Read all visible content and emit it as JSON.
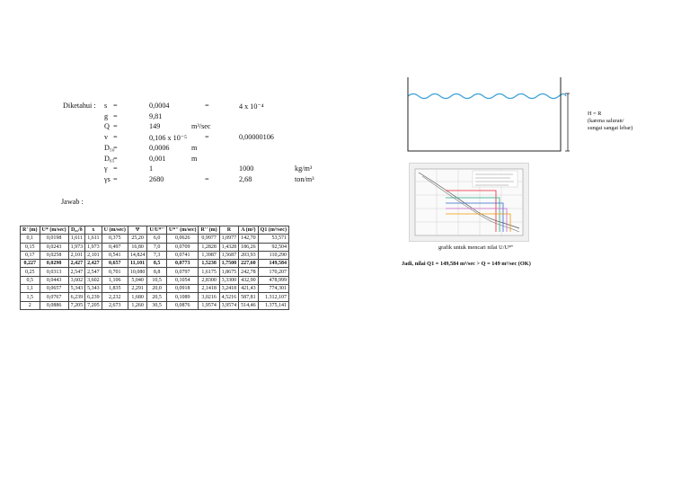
{
  "given": {
    "title": "Diketahui :",
    "rows": [
      {
        "sym": "s",
        "eq": "=",
        "val": "0,0004",
        "unit": "",
        "eq2": "=",
        "val2": "4 x 10⁻⁴",
        "unit2": ""
      },
      {
        "sym": "g",
        "eq": "=",
        "val": "9,81",
        "unit": "",
        "eq2": "",
        "val2": "",
        "unit2": ""
      },
      {
        "sym": "Q",
        "eq": "=",
        "val": "149",
        "unit": "m³/sec",
        "eq2": "",
        "val2": "",
        "unit2": ""
      },
      {
        "sym": "v",
        "eq": "=",
        "val": "0,106 x 10⁻⁵",
        "unit": "",
        "eq2": "=",
        "val2": "0,00000106",
        "unit2": ""
      },
      {
        "sym": "D₅₀",
        "eq": "=",
        "val": "0,0006",
        "unit": "m",
        "eq2": "",
        "val2": "",
        "unit2": ""
      },
      {
        "sym": "D₆₅",
        "eq": "=",
        "val": "0,001",
        "unit": "m",
        "eq2": "",
        "val2": "",
        "unit2": ""
      },
      {
        "sym": "γ",
        "eq": "=",
        "val": "1",
        "unit": "",
        "eq2": "",
        "val2": "1000",
        "unit2": "kg/m³"
      },
      {
        "sym": "γs",
        "eq": "=",
        "val": "2680",
        "unit": "",
        "eq2": "=",
        "val2": "2,68",
        "unit2": "ton/m³"
      }
    ]
  },
  "jawab": "Jawab :",
  "table": {
    "headers": [
      "R' (m)",
      "U* (m/sec)",
      "D₆₅/δ",
      "x",
      "U (m/sec)",
      "Ψ",
      "U/U*''",
      "U*'' (m/sec)",
      "R'' (m)",
      "R",
      "A (m²)",
      "Q1 (m³/sec)"
    ],
    "rows": [
      [
        "0,1",
        "0,0198",
        "1,611",
        "1,611",
        "0,375",
        "25,20",
        "6,0",
        "0,0626",
        "0,9977",
        "1,0977",
        "142,70",
        "53,571"
      ],
      [
        "0,15",
        "0,0243",
        "1,973",
        "1,973",
        "0,497",
        "16,80",
        "7,0",
        "0,0709",
        "1,2828",
        "1,4328",
        "186,26",
        "92,504"
      ],
      [
        "0,17",
        "0,0258",
        "2,101",
        "2,101",
        "0,541",
        "14,824",
        "7,3",
        "0,0741",
        "1,3987",
        "1,5687",
        "203,93",
        "110,290"
      ],
      [
        "0,227",
        "0,0298",
        "2,427",
        "2,427",
        "0,657",
        "11,101",
        "8,5",
        "0,0773",
        "1,5238",
        "1,7508",
        "227,60",
        "149,584"
      ],
      [
        "0,25",
        "0,0313",
        "2,547",
        "2,547",
        "0,701",
        "10,080",
        "8,8",
        "0,0797",
        "1,6175",
        "1,8675",
        "242,78",
        "170,207"
      ],
      [
        "0,5",
        "0,0443",
        "3,602",
        "3,602",
        "1,106",
        "5,040",
        "10,5",
        "0,1054",
        "2,8300",
        "3,3300",
        "432,90",
        "478,999"
      ],
      [
        "1,1",
        "0,0657",
        "5,343",
        "5,343",
        "1,835",
        "2,291",
        "20,0",
        "0,0918",
        "2,1418",
        "3,2418",
        "421,43",
        "774,301"
      ],
      [
        "1,5",
        "0,0767",
        "6,239",
        "6,239",
        "2,232",
        "1,680",
        "20,5",
        "0,1089",
        "3,0216",
        "4,5216",
        "587,81",
        "1.312,107"
      ],
      [
        "2",
        "0,0886",
        "7,205",
        "7,205",
        "2,673",
        "1,260",
        "30,5",
        "0,0876",
        "1,9574",
        "3,9574",
        "514,46",
        "1.375,141"
      ]
    ],
    "bold_row_index": 3
  },
  "channel_label": [
    "H = R",
    "(karena saluran/",
    "sungai sangat lebar)"
  ],
  "figure_caption": "grafik untuk mencari nilai U/U*''",
  "conclusion": "Jadi, nilai Q1 = 149,584 m³/sec > Q = 149 m³/sec (OK)"
}
